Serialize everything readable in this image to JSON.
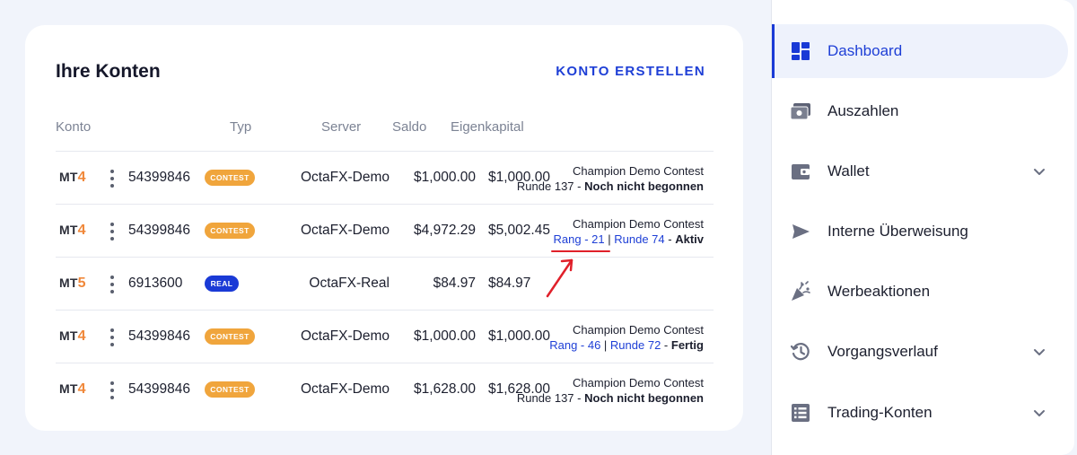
{
  "accounts_card": {
    "title": "Ihre Konten",
    "create_label": "KONTO ERSTELLEN",
    "headers": {
      "konto": "Konto",
      "typ": "Typ",
      "server": "Server",
      "saldo": "Saldo",
      "eigenkapital": "Eigenkapital"
    },
    "rows": [
      {
        "platform": "MT",
        "platform_version": "4",
        "account": "54399846",
        "badge": "CONTEST",
        "server": "OctaFX-Demo",
        "saldo": "$1,000.00",
        "eigen": "$1,000.00",
        "contest_name": "Champion Demo Contest",
        "contest_line_a": "Runde 137",
        "contest_sep": " - ",
        "contest_status": "Noch nicht begonnen"
      },
      {
        "platform": "MT",
        "platform_version": "4",
        "account": "54399846",
        "badge": "CONTEST",
        "server": "OctaFX-Demo",
        "saldo": "$4,972.29",
        "eigen": "$5,002.45",
        "contest_name": "Champion Demo Contest",
        "rank": "Rang - 21",
        "pipe": " | ",
        "round": "Runde 74",
        "contest_sep": " - ",
        "contest_status": "Aktiv"
      },
      {
        "platform": "MT",
        "platform_version": "5",
        "account": "6913600",
        "badge": "REAL",
        "server": "OctaFX-Real",
        "saldo": "$84.97",
        "eigen": "$84.97"
      },
      {
        "platform": "MT",
        "platform_version": "4",
        "account": "54399846",
        "badge": "CONTEST",
        "server": "OctaFX-Demo",
        "saldo": "$1,000.00",
        "eigen": "$1,000.00",
        "contest_name": "Champion Demo Contest",
        "rank": "Rang - 46",
        "pipe": " | ",
        "round": "Runde 72",
        "contest_sep": " - ",
        "contest_status": "Fertig"
      },
      {
        "platform": "MT",
        "platform_version": "4",
        "account": "54399846",
        "badge": "CONTEST",
        "server": "OctaFX-Demo",
        "saldo": "$1,628.00",
        "eigen": "$1,628.00",
        "contest_name": "Champion Demo Contest",
        "contest_line_a": "Runde 137",
        "contest_sep": " - ",
        "contest_status": "Noch nicht begonnen"
      }
    ]
  },
  "sidebar": {
    "items": [
      {
        "label": "Dashboard",
        "icon": "dashboard-icon",
        "active": true
      },
      {
        "label": "Auszahlen",
        "icon": "cash-icon"
      },
      {
        "label": "Wallet",
        "icon": "wallet-icon",
        "expandable": true
      },
      {
        "label": "Interne Überweisung",
        "icon": "send-icon"
      },
      {
        "label": "Werbeaktionen",
        "icon": "party-popper-icon"
      },
      {
        "label": "Vorgangsverlauf",
        "icon": "history-icon",
        "expandable": true
      },
      {
        "label": "Trading-Konten",
        "icon": "list-icon",
        "expandable": true
      }
    ]
  },
  "colors": {
    "accent": "#1e3fd6",
    "contest_badge": "#f0a53c",
    "real_badge": "#1a3ad6",
    "mt_version": "#f0883a",
    "annotation": "#e0202a"
  }
}
